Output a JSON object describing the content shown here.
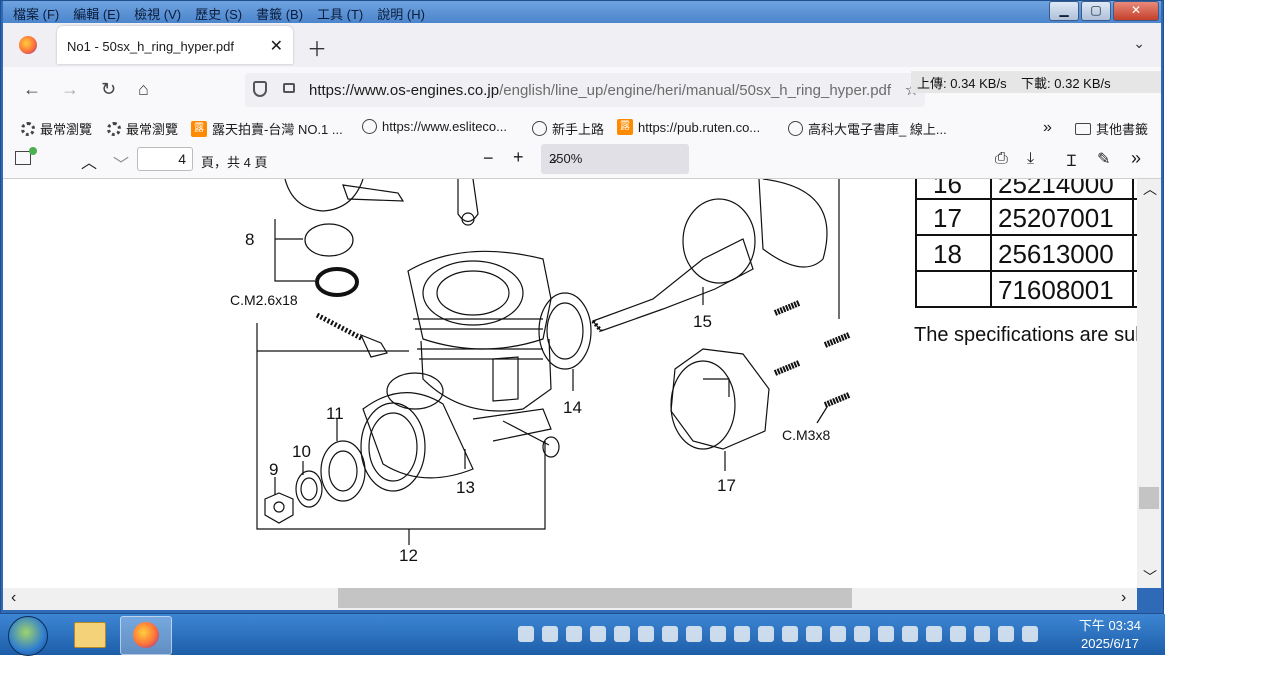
{
  "menubar": {
    "items": [
      "檔案 (F)",
      "編輯 (E)",
      "檢視 (V)",
      "歷史 (S)",
      "書籤 (B)",
      "工具 (T)",
      "說明 (H)"
    ]
  },
  "tab": {
    "title": "No1 - 50sx_h_ring_hyper.pdf",
    "close": "✕"
  },
  "nav": {
    "url_host": "https://www.os-engines.co.jp",
    "url_path": "/english/line_up/engine/heri/manual/50sx_h_ring_hyper.pdf"
  },
  "netspeed": {
    "up": "上傳: 0.34 KB/s",
    "down": "下載: 0.32 KB/s"
  },
  "bookmarks": [
    {
      "label": "最常瀏覽",
      "icon": "gear-icon"
    },
    {
      "label": "最常瀏覽",
      "icon": "gear-icon"
    },
    {
      "label": "露天拍賣-台灣 NO.1 ...",
      "icon": "ruten-icon"
    },
    {
      "label": "https://www.esliteco...",
      "icon": "globe-icon"
    },
    {
      "label": "新手上路",
      "icon": "globe-icon"
    },
    {
      "label": "https://pub.ruten.co...",
      "icon": "ruten-icon"
    },
    {
      "label": "高科大電子書庫_ 線上...",
      "icon": "globe-icon"
    },
    {
      "label": "其他書籤",
      "icon": "folder-icon"
    }
  ],
  "pdf_toolbar": {
    "page_number": "4",
    "page_total": "頁，共 4 頁",
    "zoom": "250%"
  },
  "document": {
    "labels": {
      "p8": "8",
      "p9": "9",
      "p10": "10",
      "p11": "11",
      "p12": "12",
      "p13": "13",
      "p14": "14",
      "p15": "15",
      "p17": "17",
      "screw1": "C.M2.6x18",
      "screw2": "C.M3x8"
    },
    "parts_table": [
      {
        "no": "16",
        "code": "25214000"
      },
      {
        "no": "17",
        "code": "25207001"
      },
      {
        "no": "18",
        "code": "25613000"
      },
      {
        "no": "",
        "code": "71608001"
      }
    ],
    "note": "The specifications are subje"
  },
  "taskbar": {
    "time": "下午 03:34",
    "date": "2025/6/17"
  }
}
